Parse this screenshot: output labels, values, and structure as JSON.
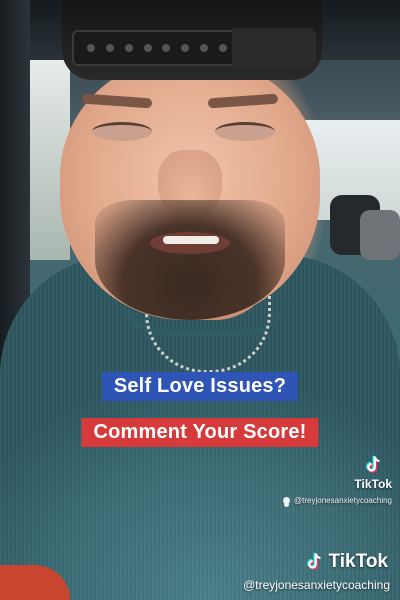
{
  "caption": {
    "line1": "Self Love Issues?",
    "line2": "Comment Your Score!"
  },
  "tiktok_small": {
    "icon": "tiktok-note-icon",
    "brand": "TikTok",
    "user_icon": "user-icon",
    "handle": "@treyjonesanxietycoaching"
  },
  "tiktok_big": {
    "icon": "tiktok-note-icon",
    "brand": "TikTok",
    "handle": "@treyjonesanxietycoaching"
  },
  "colors": {
    "caption1_bg": "#2e55b5",
    "caption2_bg": "#d63a3a",
    "tiktok_cyan": "#25f4ee",
    "tiktok_red": "#fe2c55"
  }
}
